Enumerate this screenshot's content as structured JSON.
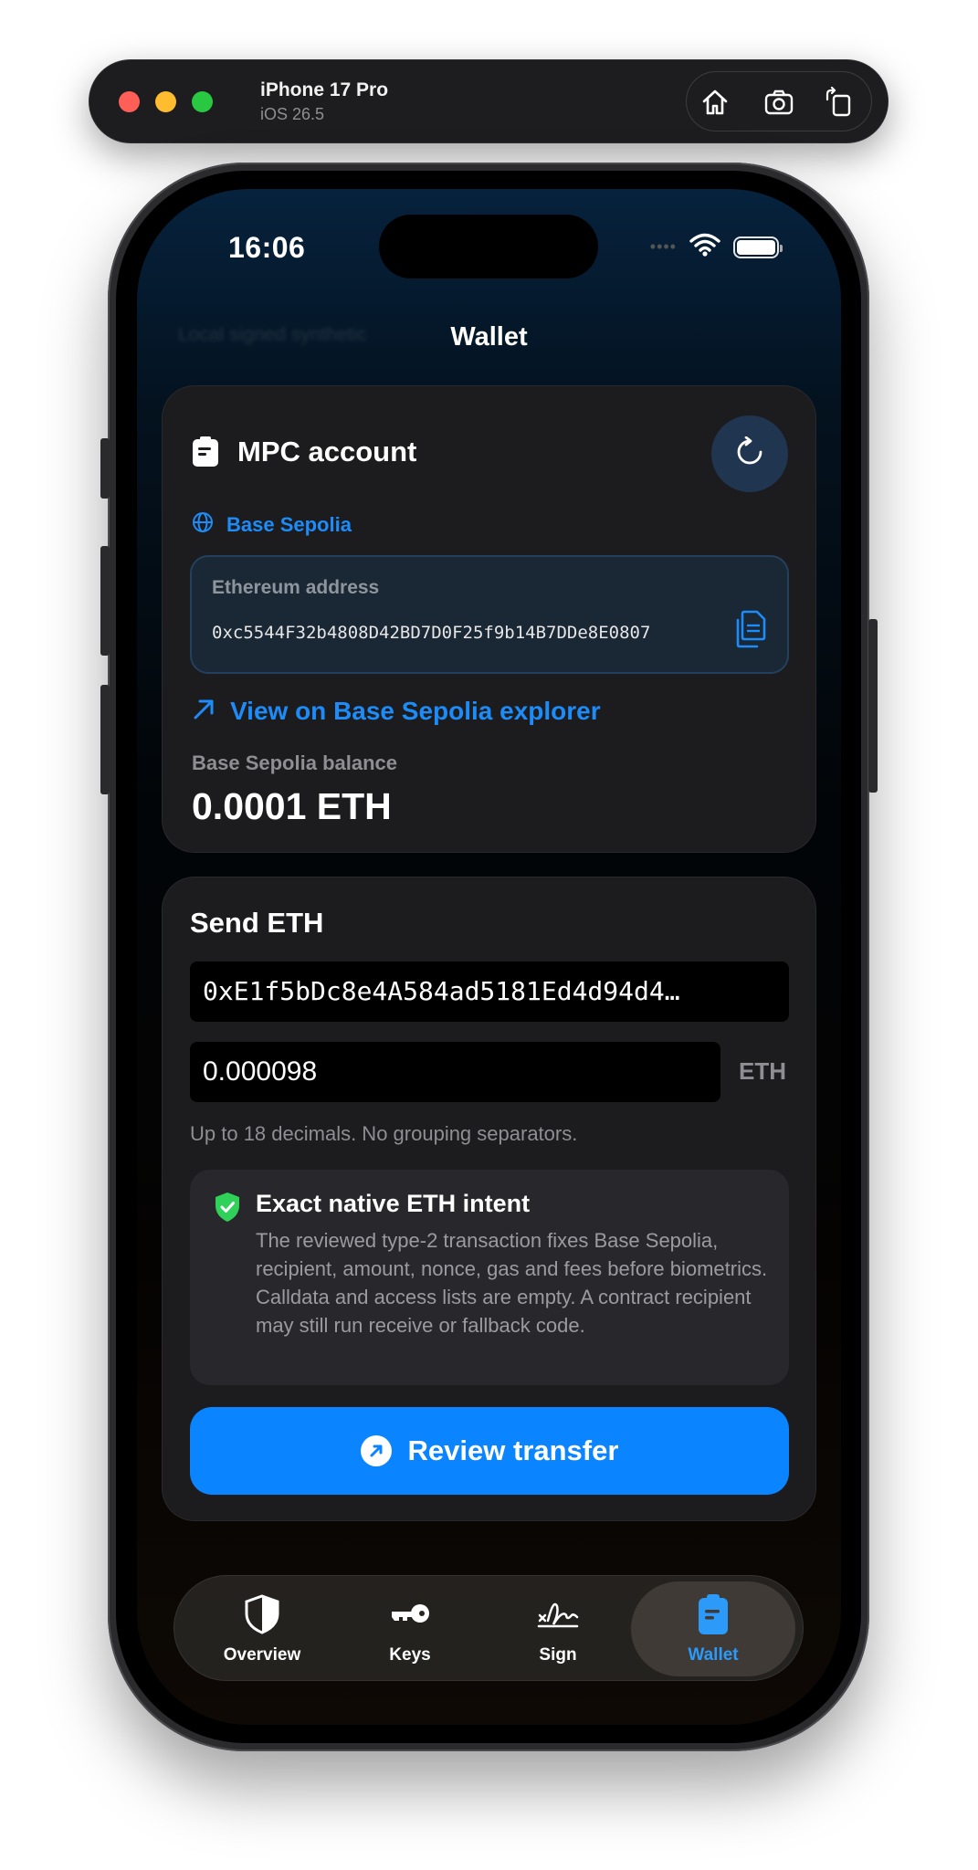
{
  "simulator": {
    "device": "iPhone 17 Pro",
    "os": "iOS 26.5"
  },
  "status_bar": {
    "time": "16:06",
    "cell_dots": "••••"
  },
  "nav": {
    "title": "Wallet",
    "ghost_text": "Local signed synthetic"
  },
  "account": {
    "title": "MPC account",
    "network": "Base Sepolia",
    "address_label": "Ethereum address",
    "address": "0xc5544F32b4808D42BD7D0F25f9b14B7DDe8E0807",
    "explorer_link": "View on Base Sepolia explorer",
    "balance_label": "Base Sepolia balance",
    "balance": "0.0001 ETH"
  },
  "send": {
    "title": "Send ETH",
    "recipient_value": "0xE1f5bDc8e4A584ad5181Ed4d94d4…",
    "amount_value": "0.000098",
    "unit": "ETH",
    "hint": "Up to 18 decimals. No grouping separators.",
    "intent_title": "Exact native ETH intent",
    "intent_body": "The reviewed type-2 transaction fixes Base Sepolia, recipient, amount, nonce, gas and fees before biometrics. Calldata and access lists are empty. A contract recipient may still run receive or fallback code.",
    "review_button": "Review transfer"
  },
  "tabs": [
    {
      "label": "Overview",
      "icon": "shield-icon"
    },
    {
      "label": "Keys",
      "icon": "key-icon"
    },
    {
      "label": "Sign",
      "icon": "signature-icon"
    },
    {
      "label": "Wallet",
      "icon": "wallet-icon",
      "active": true
    }
  ],
  "colors": {
    "accent": "#0a84ff",
    "link": "#1d8cf8",
    "success": "#30d158",
    "card": "#1c1c1f"
  }
}
